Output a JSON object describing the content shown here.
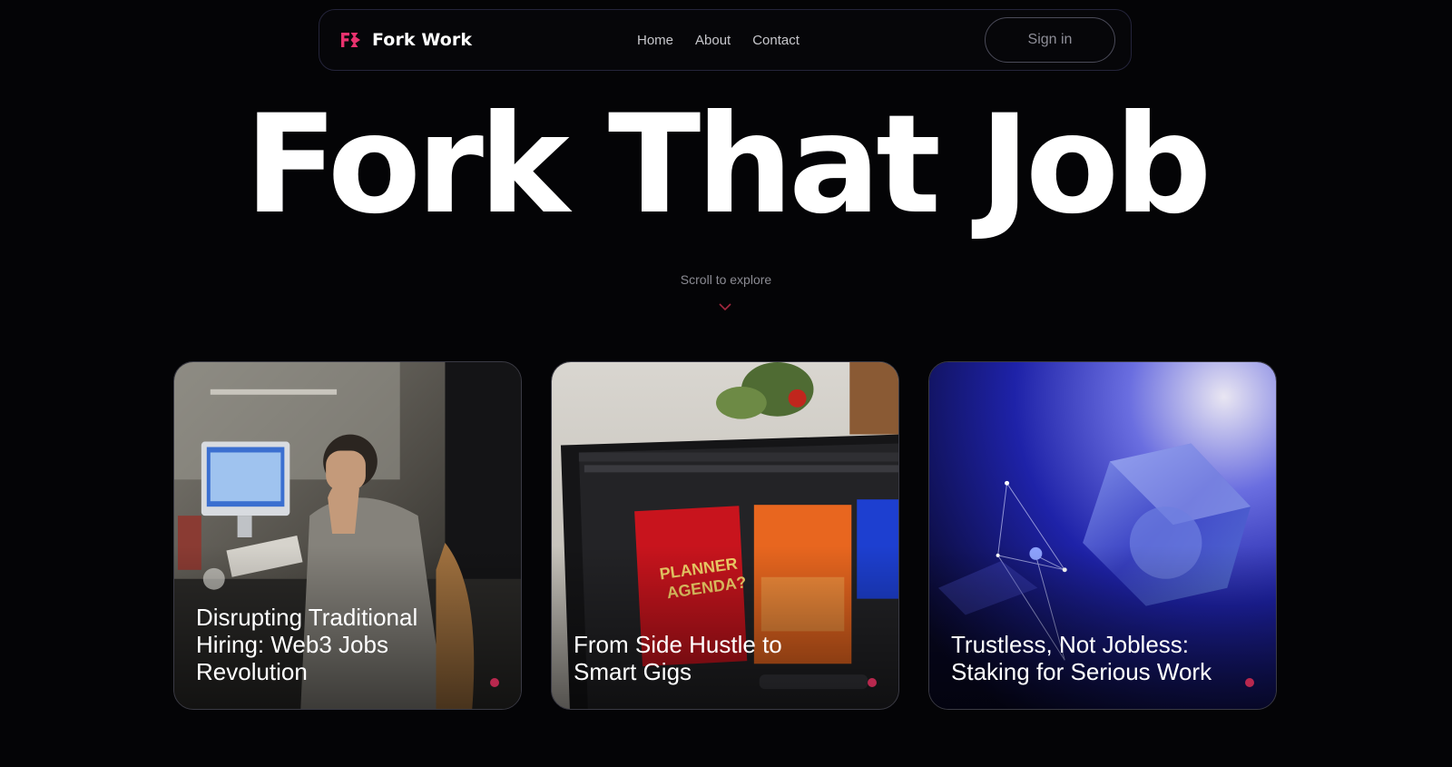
{
  "brand": {
    "name": "Fork Work",
    "logo_icon": "fork-work-logo-icon",
    "accent_color": "#e8326e"
  },
  "nav": {
    "links": [
      {
        "label": "Home"
      },
      {
        "label": "About"
      },
      {
        "label": "Contact"
      }
    ],
    "signin_label": "Sign in"
  },
  "hero": {
    "title": "Fork That Job",
    "scroll_hint": "Scroll to explore",
    "scroll_icon": "chevron-down-icon"
  },
  "cards": [
    {
      "title": "Disrupting Traditional Hiring: Web3 Jobs Revolution",
      "image": "man-at-desktop-computer-photo",
      "dot_color": "#b8284e"
    },
    {
      "title": "From Side Hustle to Smart Gigs",
      "image": "laptop-with-design-software-photo",
      "dot_color": "#b8284e"
    },
    {
      "title": "Trustless, Not Jobless: Staking for Serious Work",
      "image": "glass-cube-blue-abstract-render",
      "dot_color": "#b8284e"
    }
  ]
}
